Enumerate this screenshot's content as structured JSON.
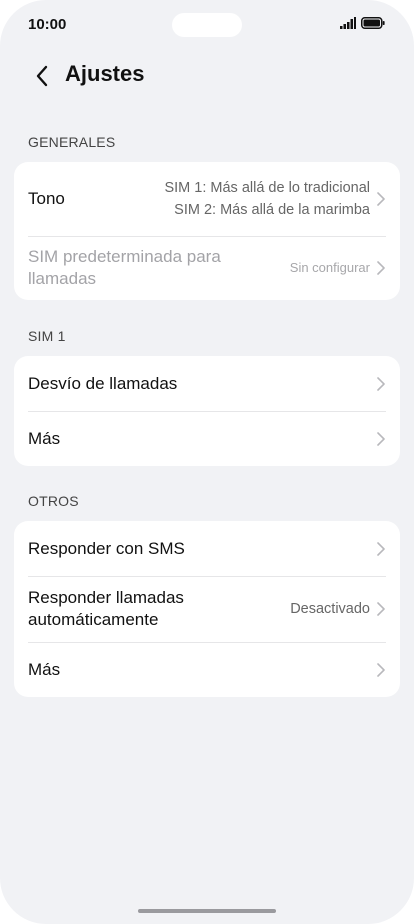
{
  "status_bar": {
    "time": "10:00",
    "icons": [
      "signal-icon",
      "battery-icon"
    ]
  },
  "header": {
    "back_icon": "chevron-left-icon",
    "title": "Ajustes"
  },
  "sections": {
    "generales": {
      "label": "GENERALES",
      "tono": {
        "title": "Tono",
        "value_line1": "SIM 1: Más allá de lo tradicional",
        "value_line2": "SIM 2: Más allá de la marimba"
      },
      "sim_predeterminada": {
        "title_line1": "SIM predeterminada para",
        "title_line2": "llamadas",
        "value": "Sin configurar",
        "disabled": true
      }
    },
    "sim1": {
      "label": "SIM 1",
      "desvio": {
        "title": "Desvío de llamadas"
      },
      "mas": {
        "title": "Más"
      }
    },
    "otros": {
      "label": "OTROS",
      "responder_sms": {
        "title": "Responder con SMS"
      },
      "responder_auto": {
        "title_line1": "Responder llamadas",
        "title_line2": "automáticamente",
        "value": "Desactivado"
      },
      "mas": {
        "title": "Más"
      }
    }
  },
  "colors": {
    "background": "#f1f2f5",
    "card": "#ffffff",
    "chevron": "#b8b8bc",
    "disabled_text": "#a3a3a7"
  }
}
